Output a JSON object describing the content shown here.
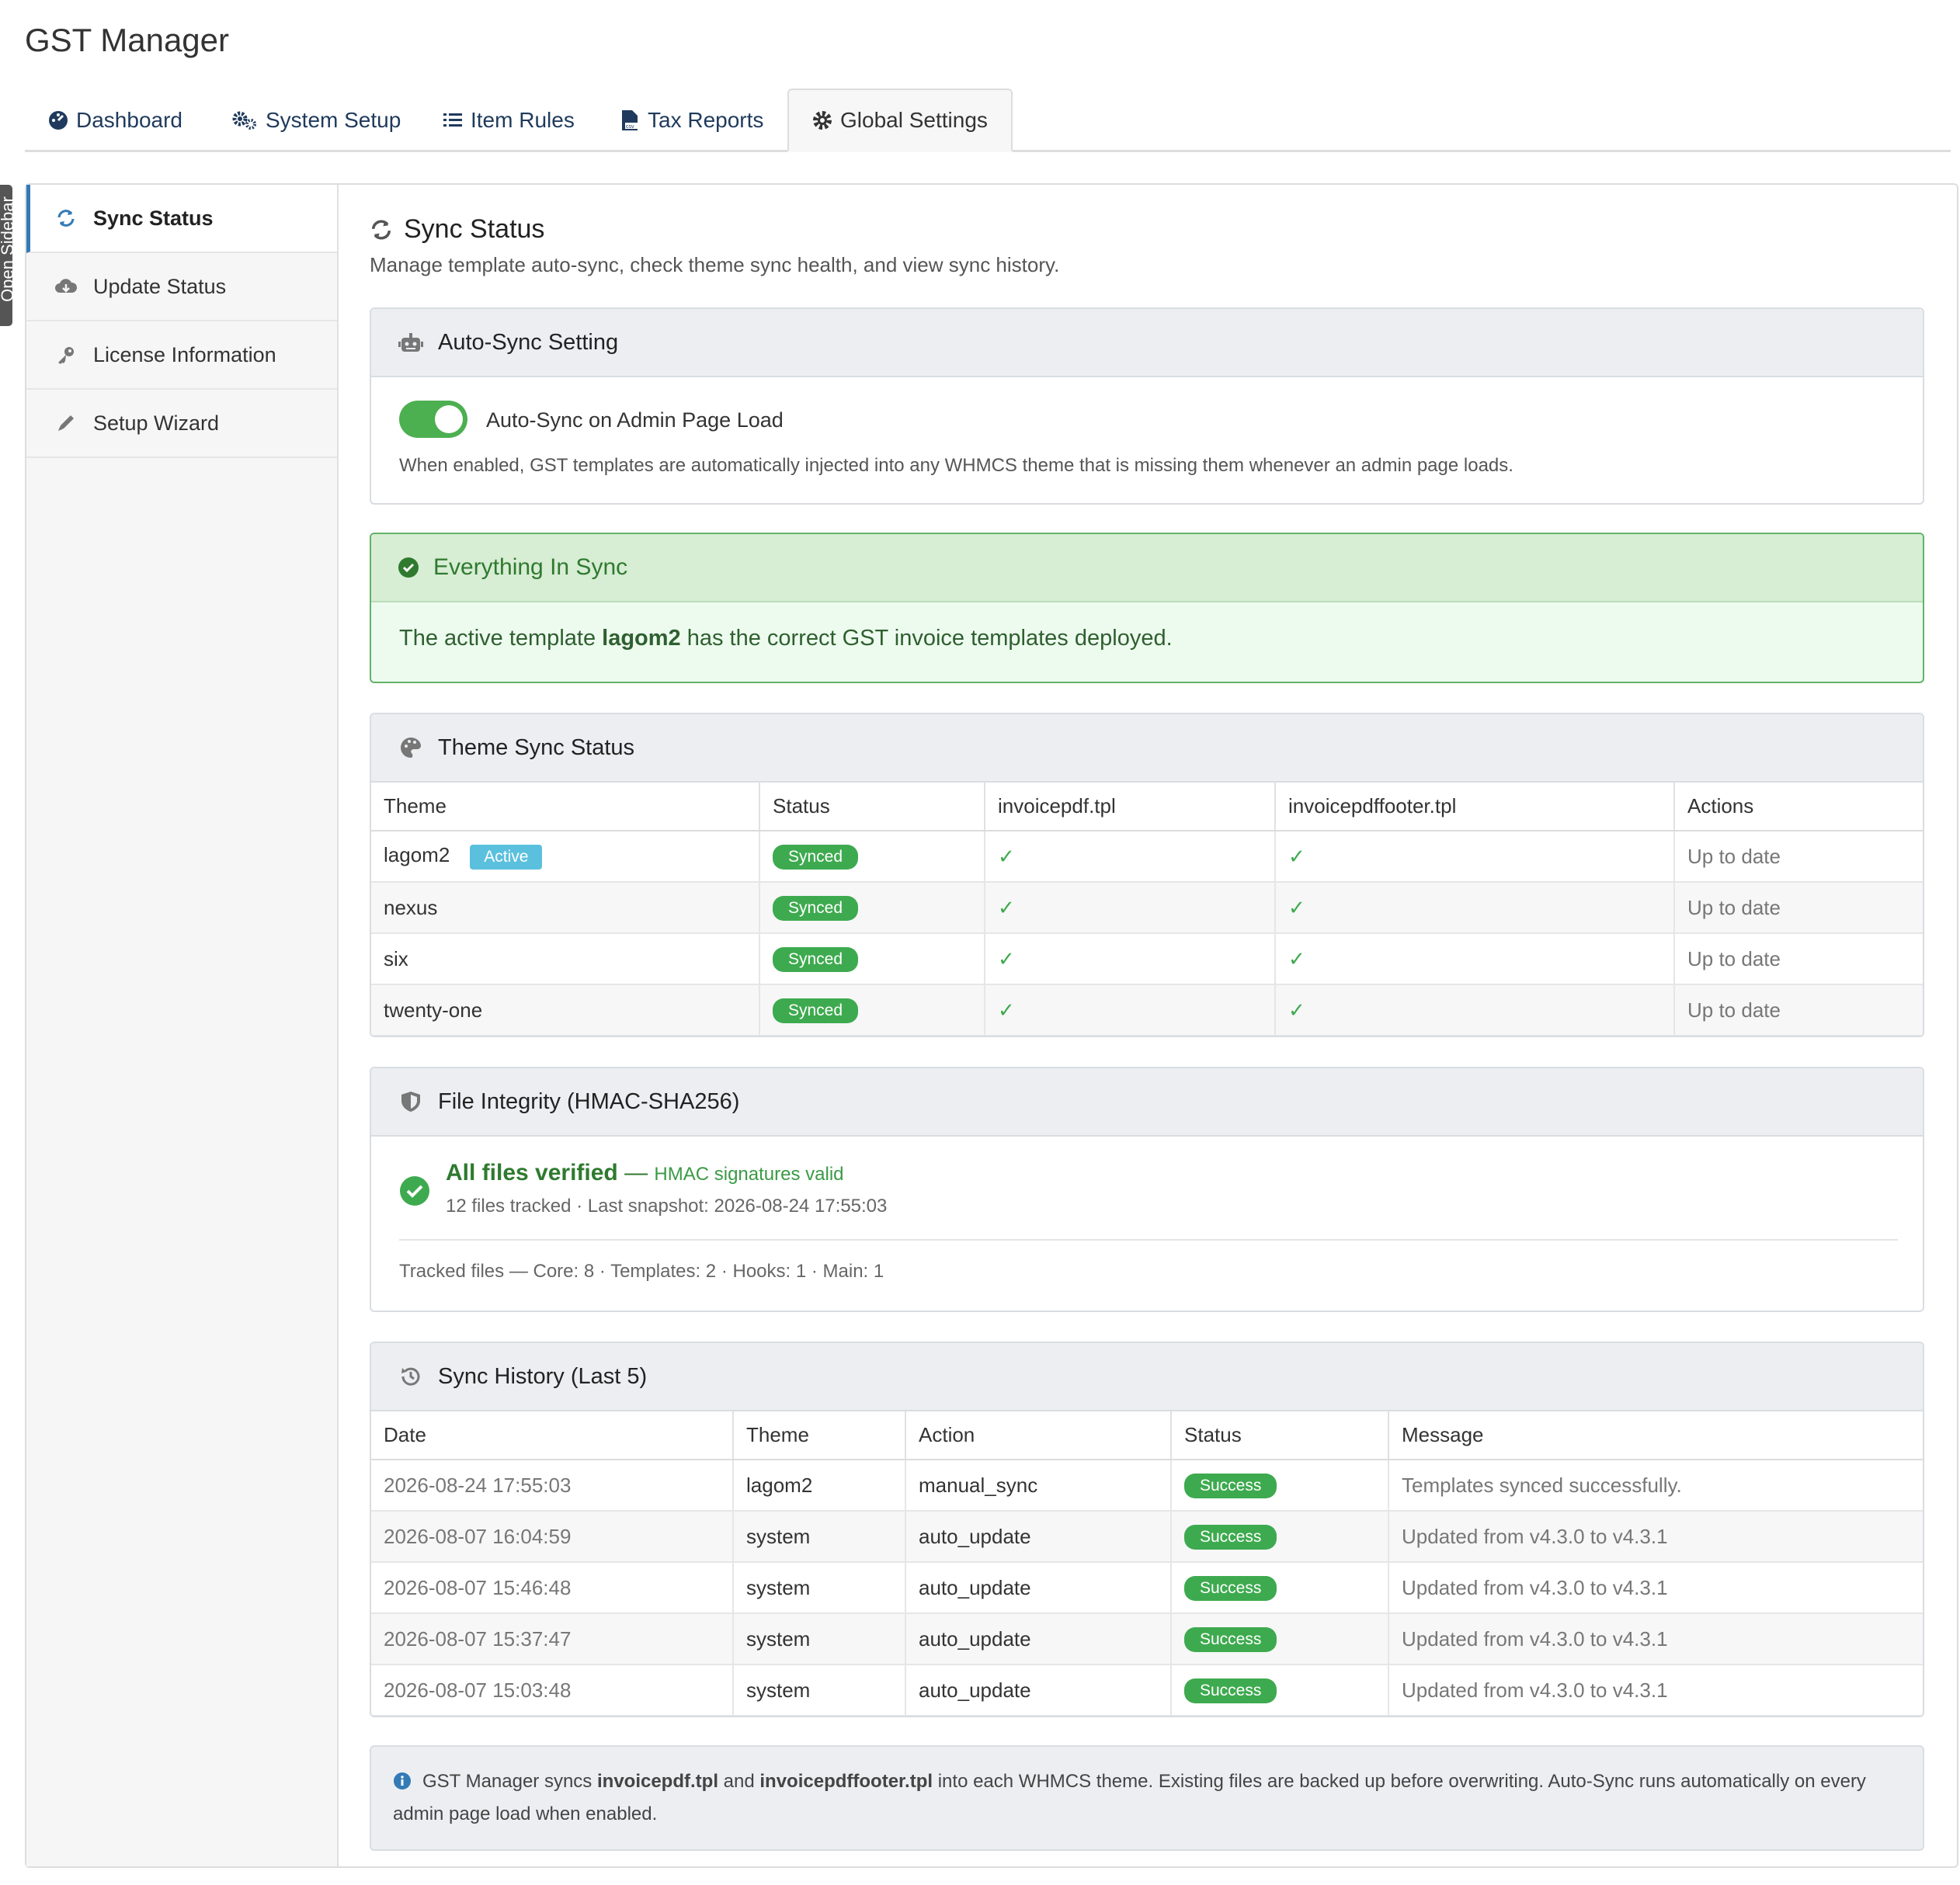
{
  "app": {
    "title": "GST Manager",
    "sidebar_toggle": "Open Sidebar"
  },
  "tabs": [
    {
      "label": "Dashboard",
      "icon": "tachometer-icon"
    },
    {
      "label": "System Setup",
      "icon": "cogs-icon"
    },
    {
      "label": "Item Rules",
      "icon": "list-icon"
    },
    {
      "label": "Tax Reports",
      "icon": "file-csv-icon"
    },
    {
      "label": "Global Settings",
      "icon": "gear-icon",
      "active": true
    }
  ],
  "sidebar": {
    "items": [
      {
        "label": "Sync Status",
        "icon": "sync-icon",
        "active": true
      },
      {
        "label": "Update Status",
        "icon": "cloud-download-icon"
      },
      {
        "label": "License Information",
        "icon": "key-icon"
      },
      {
        "label": "Setup Wizard",
        "icon": "pencil-icon"
      }
    ]
  },
  "section": {
    "title": "Sync Status",
    "subtitle": "Manage template auto-sync, check theme sync health, and view sync history."
  },
  "autosync": {
    "header": "Auto-Sync Setting",
    "toggle_label": "Auto-Sync on Admin Page Load",
    "enabled": true,
    "description": "When enabled, GST templates are automatically injected into any WHMCS theme that is missing them whenever an admin page loads."
  },
  "sync_alert": {
    "title": "Everything In Sync",
    "text_before": "The active template ",
    "template": "lagom2",
    "text_after": " has the correct GST invoice templates deployed."
  },
  "theme_sync": {
    "header": "Theme Sync Status",
    "columns": [
      "Theme",
      "Status",
      "invoicepdf.tpl",
      "invoicepdffooter.tpl",
      "Actions"
    ],
    "active_badge": "Active",
    "rows": [
      {
        "theme": "lagom2",
        "active": true,
        "status": "Synced",
        "invoicepdf": "✓",
        "footer": "✓",
        "action": "Up to date"
      },
      {
        "theme": "nexus",
        "active": false,
        "status": "Synced",
        "invoicepdf": "✓",
        "footer": "✓",
        "action": "Up to date"
      },
      {
        "theme": "six",
        "active": false,
        "status": "Synced",
        "invoicepdf": "✓",
        "footer": "✓",
        "action": "Up to date"
      },
      {
        "theme": "twenty-one",
        "active": false,
        "status": "Synced",
        "invoicepdf": "✓",
        "footer": "✓",
        "action": "Up to date"
      }
    ]
  },
  "integrity": {
    "header": "File Integrity (HMAC-SHA256)",
    "title": "All files verified",
    "dash": " — ",
    "subtitle": "HMAC signatures valid",
    "detail": "12 files tracked · Last snapshot: 2026-08-24 17:55:03",
    "tracked": "Tracked files — Core: 8 · Templates: 2 · Hooks: 1 · Main: 1"
  },
  "history": {
    "header": "Sync History (Last 5)",
    "columns": [
      "Date",
      "Theme",
      "Action",
      "Status",
      "Message"
    ],
    "rows": [
      {
        "date": "2026-08-24 17:55:03",
        "theme": "lagom2",
        "action": "manual_sync",
        "status": "Success",
        "message": "Templates synced successfully."
      },
      {
        "date": "2026-08-07 16:04:59",
        "theme": "system",
        "action": "auto_update",
        "status": "Success",
        "message": "Updated from v4.3.0 to v4.3.1"
      },
      {
        "date": "2026-08-07 15:46:48",
        "theme": "system",
        "action": "auto_update",
        "status": "Success",
        "message": "Updated from v4.3.0 to v4.3.1"
      },
      {
        "date": "2026-08-07 15:37:47",
        "theme": "system",
        "action": "auto_update",
        "status": "Success",
        "message": "Updated from v4.3.0 to v4.3.1"
      },
      {
        "date": "2026-08-07 15:03:48",
        "theme": "system",
        "action": "auto_update",
        "status": "Success",
        "message": "Updated from v4.3.0 to v4.3.1"
      }
    ]
  },
  "info": {
    "p1": "GST Manager syncs ",
    "f1": "invoicepdf.tpl",
    "p2": " and ",
    "f2": "invoicepdffooter.tpl",
    "p3": " into each WHMCS theme. Existing files are backed up before overwriting. Auto-Sync runs automatically on every admin page load when enabled."
  },
  "colors": {
    "accent": "#337ab7",
    "success": "#3eaa4f",
    "info_badge": "#5bc0de",
    "alert_bg": "#edfbef"
  }
}
